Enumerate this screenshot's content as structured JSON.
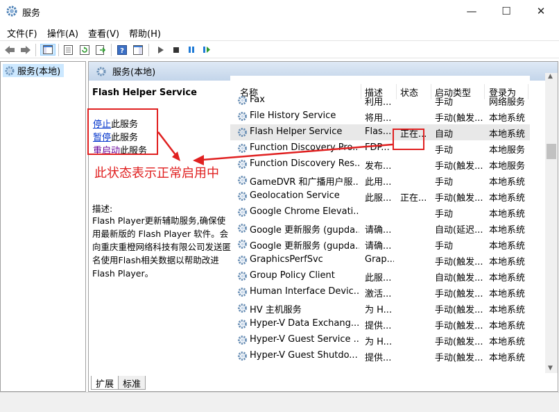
{
  "window": {
    "title": "服务",
    "min": "—",
    "max": "☐",
    "close": "✕"
  },
  "menu": [
    {
      "label": "文件(F)"
    },
    {
      "label": "操作(A)"
    },
    {
      "label": "查看(V)"
    },
    {
      "label": "帮助(H)"
    }
  ],
  "toolbar_icons": [
    "back-icon",
    "forward-icon",
    "console-tree-icon",
    "properties-icon",
    "refresh-icon",
    "export-icon",
    "help-icon",
    "action-pane-icon",
    "start-icon",
    "stop-icon",
    "pause-icon",
    "restart-icon"
  ],
  "tree": {
    "item": "服务(本地)"
  },
  "pane": {
    "header": "服务(本地)",
    "service_title": "Flash Helper Service",
    "actions": [
      {
        "link": "停止",
        "rest": "此服务"
      },
      {
        "link": "暂停",
        "rest": "此服务"
      },
      {
        "link": "重启动",
        "rest": "此服务"
      }
    ],
    "annotation": "此状态表示正常启用中",
    "desc_label": "描述:",
    "desc_text": "Flash Player更新辅助服务,确保使用最新版的 Flash Player 软件。会向重庆重橙网络科技有限公司发送匿名使用Flash相关数据以帮助改进 Flash Player。"
  },
  "list": {
    "sort_indicator": "^",
    "columns": [
      "名称",
      "描述",
      "状态",
      "启动类型",
      "登录为"
    ],
    "rows": [
      {
        "name": "Fax",
        "desc": "利用...",
        "status": "",
        "startup": "手动",
        "logon": "网络服务"
      },
      {
        "name": "File History Service",
        "desc": "将用...",
        "status": "",
        "startup": "手动(触发...",
        "logon": "本地系统"
      },
      {
        "name": "Flash Helper Service",
        "desc": "Flas...",
        "status": "正在...",
        "startup": "自动",
        "logon": "本地系统",
        "selected": true
      },
      {
        "name": "Function Discovery Pro...",
        "desc": "FDP...",
        "status": "",
        "startup": "手动",
        "logon": "本地服务"
      },
      {
        "name": "Function Discovery Res...",
        "desc": "发布...",
        "status": "",
        "startup": "手动(触发...",
        "logon": "本地服务"
      },
      {
        "name": "GameDVR 和广播用户服...",
        "desc": "此用...",
        "status": "",
        "startup": "手动",
        "logon": "本地系统"
      },
      {
        "name": "Geolocation Service",
        "desc": "此服...",
        "status": "正在...",
        "startup": "手动(触发...",
        "logon": "本地系统"
      },
      {
        "name": "Google Chrome Elevati...",
        "desc": "",
        "status": "",
        "startup": "手动",
        "logon": "本地系统"
      },
      {
        "name": "Google 更新服务 (gupda...",
        "desc": "请确...",
        "status": "",
        "startup": "自动(延迟...",
        "logon": "本地系统"
      },
      {
        "name": "Google 更新服务 (gupda...",
        "desc": "请确...",
        "status": "",
        "startup": "手动",
        "logon": "本地系统"
      },
      {
        "name": "GraphicsPerfSvc",
        "desc": "Grap...",
        "status": "",
        "startup": "手动(触发...",
        "logon": "本地系统"
      },
      {
        "name": "Group Policy Client",
        "desc": "此服...",
        "status": "",
        "startup": "自动(触发...",
        "logon": "本地系统"
      },
      {
        "name": "Human Interface Devic...",
        "desc": "激活...",
        "status": "",
        "startup": "手动(触发...",
        "logon": "本地系统"
      },
      {
        "name": "HV 主机服务",
        "desc": "为 H...",
        "status": "",
        "startup": "手动(触发...",
        "logon": "本地系统"
      },
      {
        "name": "Hyper-V Data Exchang...",
        "desc": "提供...",
        "status": "",
        "startup": "手动(触发...",
        "logon": "本地系统"
      },
      {
        "name": "Hyper-V Guest Service ...",
        "desc": "为 H...",
        "status": "",
        "startup": "手动(触发...",
        "logon": "本地系统"
      },
      {
        "name": "Hyper-V Guest Shutdo...",
        "desc": "提供...",
        "status": "",
        "startup": "手动(触发...",
        "logon": "本地系统"
      }
    ]
  },
  "tabs": [
    "扩展",
    "标准"
  ],
  "colors": {
    "annotation": "#e02020",
    "link": "#0033cc",
    "header_gradient": "#c3d5ea"
  }
}
